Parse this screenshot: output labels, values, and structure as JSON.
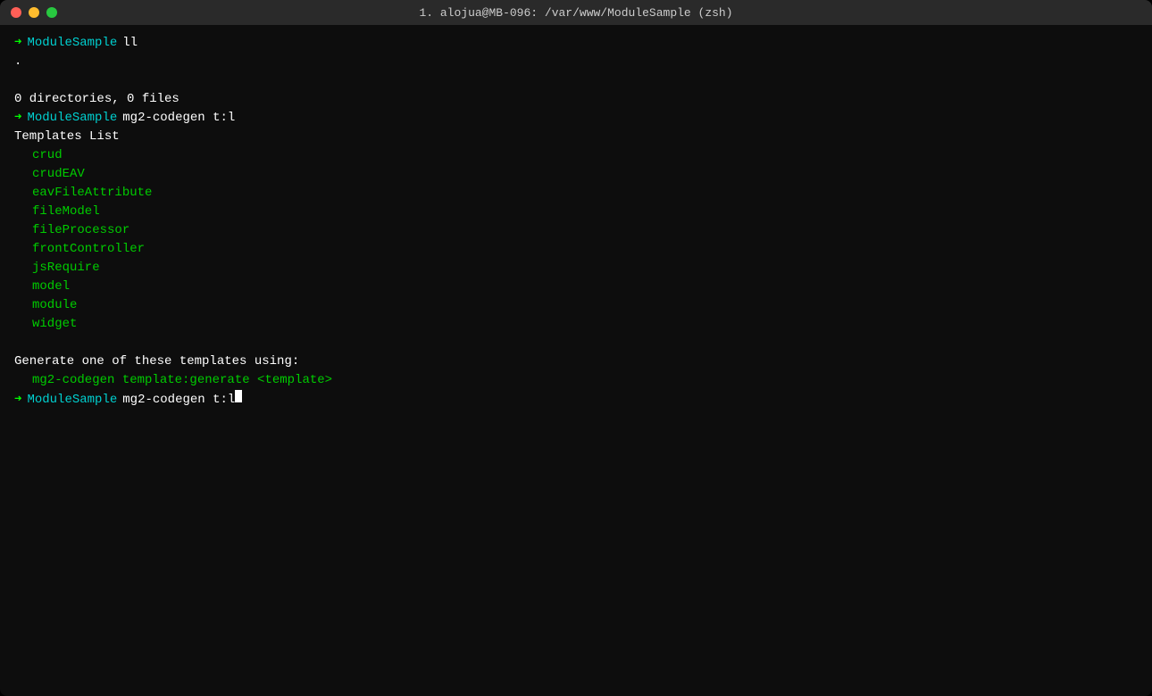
{
  "window": {
    "title": "1. alojua@MB-096: /var/www/ModuleSample (zsh)",
    "buttons": {
      "close": "close",
      "minimize": "minimize",
      "maximize": "maximize"
    }
  },
  "terminal": {
    "lines": [
      {
        "type": "prompt",
        "dir": "ModuleSample",
        "cmd": "ll"
      },
      {
        "type": "output-white",
        "text": "."
      },
      {
        "type": "empty"
      },
      {
        "type": "output-white",
        "text": "0 directories, 0 files"
      },
      {
        "type": "prompt",
        "dir": "ModuleSample",
        "cmd": "mg2-codegen t:l"
      },
      {
        "type": "output-white",
        "text": "Templates List"
      },
      {
        "type": "output-indent",
        "text": "crud"
      },
      {
        "type": "output-indent",
        "text": "crudEAV"
      },
      {
        "type": "output-indent",
        "text": "eavFileAttribute"
      },
      {
        "type": "output-indent",
        "text": "fileModel"
      },
      {
        "type": "output-indent",
        "text": "fileProcessor"
      },
      {
        "type": "output-indent",
        "text": "frontController"
      },
      {
        "type": "output-indent",
        "text": "jsRequire"
      },
      {
        "type": "output-indent",
        "text": "model"
      },
      {
        "type": "output-indent",
        "text": "module"
      },
      {
        "type": "output-indent",
        "text": "widget"
      },
      {
        "type": "empty"
      },
      {
        "type": "output-white",
        "text": "Generate one of these templates using:"
      },
      {
        "type": "output-indent",
        "text": "mg2-codegen template:generate <template>"
      },
      {
        "type": "prompt-active",
        "dir": "ModuleSample",
        "cmd": "mg2-codegen t:l"
      }
    ]
  }
}
